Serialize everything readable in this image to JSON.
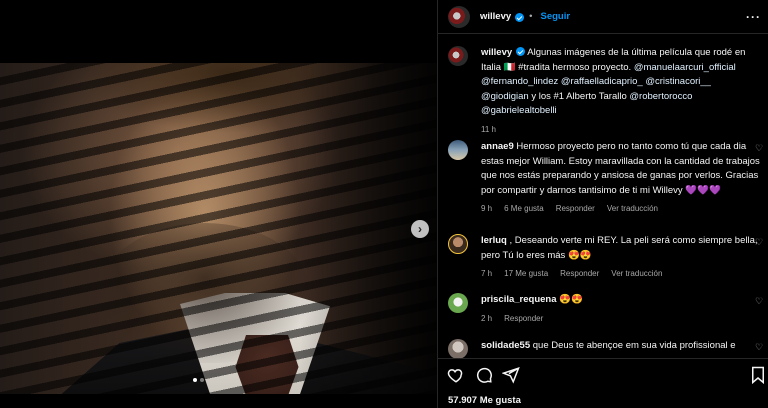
{
  "colors": {
    "accent": "#0095f6",
    "muted": "#a8a8a8",
    "background": "#000000"
  },
  "header": {
    "username": "willevy",
    "follow_label": "Seguir",
    "more_icon": "more-dots-icon"
  },
  "caption": {
    "username": "willevy",
    "text_lead": "Algunas imágenes de la última película que rodé en Italia 🇮🇹 #tradita hermoso proyecto.",
    "mentions_1": "@manuelaarcuri_official",
    "mentions_2": "@fernando_lindez @raffaelladicaprio_ @cristinacori__",
    "mentions_3": "@giodigian",
    "text_mid": "y los #1 Alberto Tarallo",
    "mentions_4": "@robertorocco",
    "mentions_5": "@gabrielealtobelli",
    "time": "11 h"
  },
  "comments": [
    {
      "username": "annae9",
      "text": "Hermoso proyecto pero no tanto como tú que cada dia estas mejor William. Estoy maravillada con la cantidad de trabajos que nos estás preparando y ansiosa de ganas por verlos. Gracias por compartir y darnos tantisimo de ti mi Willevy 💜💜💜",
      "time": "9 h",
      "likes": "6 Me gusta",
      "reply": "Responder",
      "translate": "Ver traducción"
    },
    {
      "username": "lerluq",
      "text": ", Deseando verte mi REY. La peli será como siempre bella, pero Tú lo eres más 😍😍",
      "time": "7 h",
      "likes": "17 Me gusta",
      "reply": "Responder",
      "translate": "Ver traducción"
    },
    {
      "username": "priscila_requena",
      "text": "😍😍",
      "time": "2 h",
      "reply": "Responder"
    },
    {
      "username": "solidade55",
      "text": "que Deus te abençoe em sua vida profissional e"
    }
  ],
  "actions": {
    "like_icon": "heart-icon",
    "comment_icon": "comment-icon",
    "share_icon": "share-icon",
    "save_icon": "bookmark-icon"
  },
  "likes_count": "57.907 Me gusta",
  "media": {
    "next_icon": "chevron-right-icon",
    "slides": 2,
    "active_slide": 1
  }
}
